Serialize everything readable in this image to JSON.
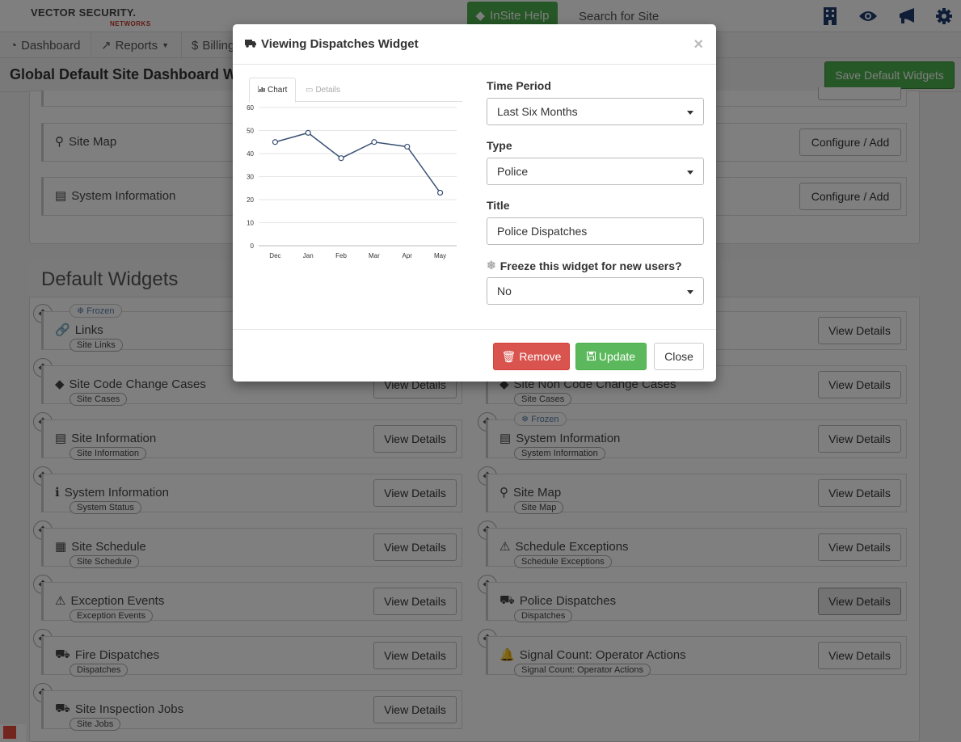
{
  "header": {
    "logo_text": "VECTOR SECURITY.",
    "logo_sub": "NETWORKS",
    "help_button": "InSite Help",
    "search_placeholder": "Search for Site",
    "icons": [
      "building-icon",
      "eye-icon",
      "megaphone-icon",
      "gear-icon"
    ]
  },
  "nav": {
    "items": [
      {
        "label": "Dashboard",
        "icon": "dashboard-icon"
      },
      {
        "label": "Reports",
        "icon": "line-chart-icon"
      },
      {
        "label": "Billing",
        "icon": "dollar-icon"
      }
    ]
  },
  "page": {
    "title": "Global Default Site Dashboard Wi",
    "save_button": "Save Default Widgets"
  },
  "available_widgets": [
    {
      "name": "Site Map",
      "icon": "map-marker-icon",
      "button": "Configure / Add"
    },
    {
      "name": "System Information",
      "icon": "server-icon",
      "button": "Configure / Add"
    }
  ],
  "default_widgets": {
    "title": "Default Widgets",
    "left": [
      {
        "name": "Links",
        "tag": "Site Links",
        "frozen": "Frozen",
        "icon": "link-icon",
        "button": "View Details"
      },
      {
        "name": "Site Code Change Cases",
        "tag": "Site Cases",
        "icon": "tag-icon",
        "button": "View Details"
      },
      {
        "name": "Site Information",
        "tag": "Site Information",
        "icon": "server-icon",
        "button": "View Details"
      },
      {
        "name": "System Information",
        "tag": "System Status",
        "icon": "info-icon",
        "button": "View Details"
      },
      {
        "name": "Site Schedule",
        "tag": "Site Schedule",
        "icon": "calendar-icon",
        "button": "View Details"
      },
      {
        "name": "Exception Events",
        "tag": "Exception Events",
        "icon": "warning-icon",
        "button": "View Details"
      },
      {
        "name": "Fire Dispatches",
        "tag": "Dispatches",
        "icon": "truck-icon",
        "button": "View Details"
      },
      {
        "name": "Site Inspection Jobs",
        "tag": "Site Jobs",
        "icon": "truck-icon",
        "button": "View Details"
      }
    ],
    "right": [
      {
        "name": "",
        "tag": "",
        "icon": "",
        "button": "View Details"
      },
      {
        "name": "Site Non Code Change Cases",
        "tag": "Site Cases",
        "icon": "tag-icon",
        "button": "View Details"
      },
      {
        "name": "System Information",
        "tag": "System Information",
        "frozen": "Frozen",
        "icon": "server-icon",
        "button": "View Details"
      },
      {
        "name": "Site Map",
        "tag": "Site Map",
        "icon": "map-marker-icon",
        "button": "View Details"
      },
      {
        "name": "Schedule Exceptions",
        "tag": "Schedule Exceptions",
        "icon": "warning-icon",
        "button": "View Details"
      },
      {
        "name": "Police Dispatches",
        "tag": "Dispatches",
        "icon": "truck-icon",
        "button": "View Details",
        "active": true
      },
      {
        "name": "Signal Count: Operator Actions",
        "tag": "Signal Count: Operator Actions",
        "icon": "bell-icon",
        "button": "View Details"
      }
    ]
  },
  "modal": {
    "title": "Viewing Dispatches Widget",
    "close": "×",
    "tabs": [
      {
        "label": "Chart",
        "icon": "bar-chart-icon",
        "active": true
      },
      {
        "label": "Details",
        "icon": "list-icon",
        "active": false
      }
    ],
    "fields": {
      "time_period_label": "Time Period",
      "time_period_value": "Last Six Months",
      "type_label": "Type",
      "type_value": "Police",
      "title_label": "Title",
      "title_value": "Police Dispatches",
      "freeze_label": "Freeze this widget for new users?",
      "freeze_value": "No"
    },
    "buttons": {
      "remove": "Remove",
      "update": "Update",
      "close": "Close"
    }
  },
  "chart_data": {
    "type": "line",
    "x": [
      "Dec",
      "Jan",
      "Feb",
      "Mar",
      "Apr",
      "May"
    ],
    "series": [
      {
        "values": [
          45,
          49,
          38,
          45,
          43,
          23
        ]
      }
    ],
    "ylim": [
      0,
      60
    ],
    "yticks": [
      0,
      10,
      20,
      30,
      40,
      50,
      60
    ],
    "grid": true,
    "color": "#3b5176"
  }
}
